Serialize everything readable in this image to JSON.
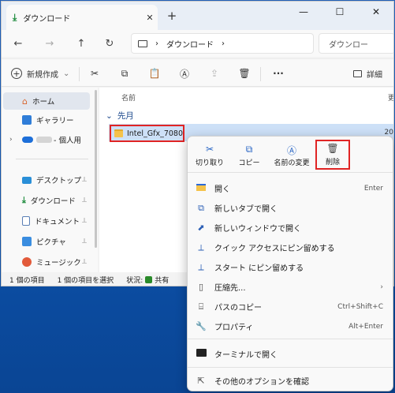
{
  "window": {
    "tab_title": "ダウンロード",
    "tab_close": "✕",
    "new_tab": "+",
    "minimize": "—",
    "maximize": "☐",
    "close": "✕"
  },
  "navbar": {
    "back": "←",
    "forward": "→",
    "up": "↑",
    "refresh": "↻",
    "breadcrumb_sep": "›",
    "breadcrumb_current": "ダウンロード",
    "breadcrumb_chevron": "›",
    "search_placeholder": "ダウンロー"
  },
  "toolbar": {
    "new_label": "新規作成",
    "new_chevron": "⌄",
    "more": "···",
    "details_label": "詳細"
  },
  "sidebar": {
    "items": [
      {
        "label": "ホーム"
      },
      {
        "label": "ギャラリー"
      },
      {
        "label": "- 個人用"
      },
      {
        "label": "デスクトップ",
        "pin": "📌"
      },
      {
        "label": "ダウンロード",
        "pin": "📌"
      },
      {
        "label": "ドキュメント",
        "pin": "📌"
      },
      {
        "label": "ピクチャ",
        "pin": "📌"
      },
      {
        "label": "ミュージック",
        "pin": "📌"
      }
    ]
  },
  "content": {
    "column_name": "名前",
    "column_updated": "更",
    "group_label": "先月",
    "file_name": "Intel_Gfx_7080",
    "file_date": "20"
  },
  "statusbar": {
    "count": "1 個の項目",
    "selected": "1 個の項目を選択",
    "state_label": "状況:",
    "state_value": "共有"
  },
  "context_menu": {
    "top_buttons": [
      {
        "label": "切り取り",
        "icon": "scissors-icon"
      },
      {
        "label": "コピー",
        "icon": "copy-icon"
      },
      {
        "label": "名前の変更",
        "icon": "rename-icon"
      },
      {
        "label": "削除",
        "icon": "trash-icon"
      }
    ],
    "items": [
      {
        "label": "開く",
        "shortcut": "Enter"
      },
      {
        "label": "新しいタブで開く",
        "shortcut": ""
      },
      {
        "label": "新しいウィンドウで開く",
        "shortcut": ""
      },
      {
        "label": "クイック アクセスにピン留めする",
        "shortcut": ""
      },
      {
        "label": "スタート にピン留めする",
        "shortcut": ""
      },
      {
        "label": "圧縮先...",
        "shortcut": "›"
      },
      {
        "label": "パスのコピー",
        "shortcut": "Ctrl+Shift+C"
      },
      {
        "label": "プロパティ",
        "shortcut": "Alt+Enter"
      },
      {
        "label": "ターミナルで開く",
        "shortcut": ""
      },
      {
        "label": "その他のオプションを確認",
        "shortcut": ""
      }
    ]
  },
  "colors": {
    "accent": "#2563c4",
    "highlight_border": "#e02424",
    "selected_row": "#cde0f7",
    "folder": "#f5c34b"
  }
}
